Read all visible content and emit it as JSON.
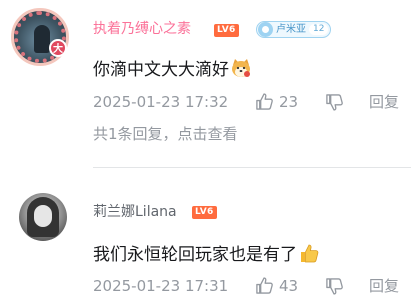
{
  "comments": [
    {
      "username": "执着乃缚心之素",
      "level": "LV6",
      "avatar_badge": "大",
      "fan_badge": {
        "name": "卢米亚",
        "level": "12",
        "color": "#a0d3f0"
      },
      "content": "你滴中文大大滴好",
      "content_emoji": "shiba-emoji",
      "time": "2025-01-23 17:32",
      "likes": "23",
      "reply_label": "回复",
      "replies_summary": "共1条回复，点击查看"
    },
    {
      "username": "莉兰娜Lilana",
      "level": "LV6",
      "content": "我们永恒轮回玩家也是有了",
      "content_emoji": "thumbs-up-emoji",
      "time": "2025-01-23 17:31",
      "likes": "43",
      "reply_label": "回复"
    }
  ],
  "colors": {
    "username_vip": "#fb7299",
    "username": "#61666d",
    "level_badge": "#ff6b3e",
    "meta_text": "#9499a0",
    "divider": "#e3e5e7"
  }
}
